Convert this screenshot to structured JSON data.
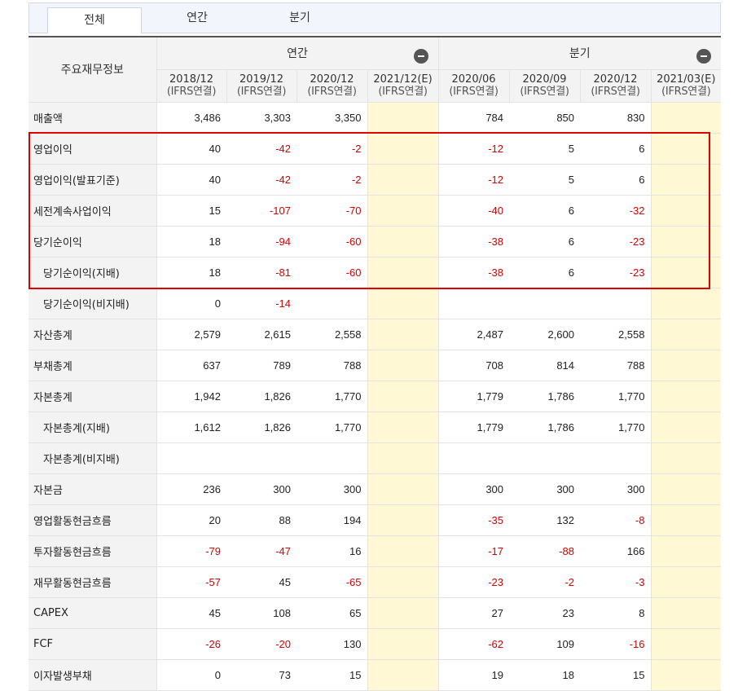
{
  "tabs": [
    {
      "label": "전체",
      "active": true
    },
    {
      "label": "연간"
    },
    {
      "label": "분기"
    }
  ],
  "header": {
    "row_label": "주요재무정보",
    "annual_group": "연간",
    "quarter_group": "분기",
    "columns": [
      {
        "period": "2018/12",
        "basis": "(IFRS연결)"
      },
      {
        "period": "2019/12",
        "basis": "(IFRS연결)"
      },
      {
        "period": "2020/12",
        "basis": "(IFRS연결)"
      },
      {
        "period": "2021/12(E)",
        "basis": "(IFRS연결)"
      },
      {
        "period": "2020/06",
        "basis": "(IFRS연결)"
      },
      {
        "period": "2020/09",
        "basis": "(IFRS연결)"
      },
      {
        "period": "2020/12",
        "basis": "(IFRS연결)"
      },
      {
        "period": "2021/03(E)",
        "basis": "(IFRS연결)"
      }
    ]
  },
  "rows": [
    {
      "label": "매출액",
      "indent": false,
      "values": [
        "3,486",
        "3,303",
        "3,350",
        "",
        "784",
        "850",
        "830",
        ""
      ]
    },
    {
      "label": "영업이익",
      "indent": false,
      "values": [
        "40",
        "-42",
        "-2",
        "",
        "-12",
        "5",
        "6",
        ""
      ]
    },
    {
      "label": "영업이익(발표기준)",
      "indent": false,
      "values": [
        "40",
        "-42",
        "-2",
        "",
        "-12",
        "5",
        "6",
        ""
      ]
    },
    {
      "label": "세전계속사업이익",
      "indent": false,
      "values": [
        "15",
        "-107",
        "-70",
        "",
        "-40",
        "6",
        "-32",
        ""
      ]
    },
    {
      "label": "당기순이익",
      "indent": false,
      "values": [
        "18",
        "-94",
        "-60",
        "",
        "-38",
        "6",
        "-23",
        ""
      ]
    },
    {
      "label": "당기순이익(지배)",
      "indent": true,
      "values": [
        "18",
        "-81",
        "-60",
        "",
        "-38",
        "6",
        "-23",
        ""
      ]
    },
    {
      "label": "당기순이익(비지배)",
      "indent": true,
      "values": [
        "0",
        "-14",
        "",
        "",
        "",
        "",
        "",
        ""
      ]
    },
    {
      "label": "자산총계",
      "indent": false,
      "values": [
        "2,579",
        "2,615",
        "2,558",
        "",
        "2,487",
        "2,600",
        "2,558",
        ""
      ]
    },
    {
      "label": "부채총계",
      "indent": false,
      "values": [
        "637",
        "789",
        "788",
        "",
        "708",
        "814",
        "788",
        ""
      ]
    },
    {
      "label": "자본총계",
      "indent": false,
      "values": [
        "1,942",
        "1,826",
        "1,770",
        "",
        "1,779",
        "1,786",
        "1,770",
        ""
      ]
    },
    {
      "label": "자본총계(지배)",
      "indent": true,
      "values": [
        "1,612",
        "1,826",
        "1,770",
        "",
        "1,779",
        "1,786",
        "1,770",
        ""
      ]
    },
    {
      "label": "자본총계(비지배)",
      "indent": true,
      "values": [
        "",
        "",
        "",
        "",
        "",
        "",
        "",
        ""
      ]
    },
    {
      "label": "자본금",
      "indent": false,
      "values": [
        "236",
        "300",
        "300",
        "",
        "300",
        "300",
        "300",
        ""
      ]
    },
    {
      "label": "영업활동현금흐름",
      "indent": false,
      "values": [
        "20",
        "88",
        "194",
        "",
        "-35",
        "132",
        "-8",
        ""
      ]
    },
    {
      "label": "투자활동현금흐름",
      "indent": false,
      "values": [
        "-79",
        "-47",
        "16",
        "",
        "-17",
        "-88",
        "166",
        ""
      ]
    },
    {
      "label": "재무활동현금흐름",
      "indent": false,
      "values": [
        "-57",
        "45",
        "-65",
        "",
        "-23",
        "-2",
        "-3",
        ""
      ]
    },
    {
      "label": "CAPEX",
      "indent": false,
      "values": [
        "45",
        "108",
        "65",
        "",
        "27",
        "23",
        "8",
        ""
      ]
    },
    {
      "label": "FCF",
      "indent": false,
      "values": [
        "-26",
        "-20",
        "130",
        "",
        "-62",
        "109",
        "-16",
        ""
      ]
    },
    {
      "label": "이자발생부채",
      "indent": false,
      "values": [
        "0",
        "73",
        "15",
        "",
        "19",
        "18",
        "15",
        ""
      ]
    }
  ],
  "colors": {
    "negative": "#d40000",
    "estimate_bg": "#fff8d4",
    "highlight_border": "#e00000"
  }
}
